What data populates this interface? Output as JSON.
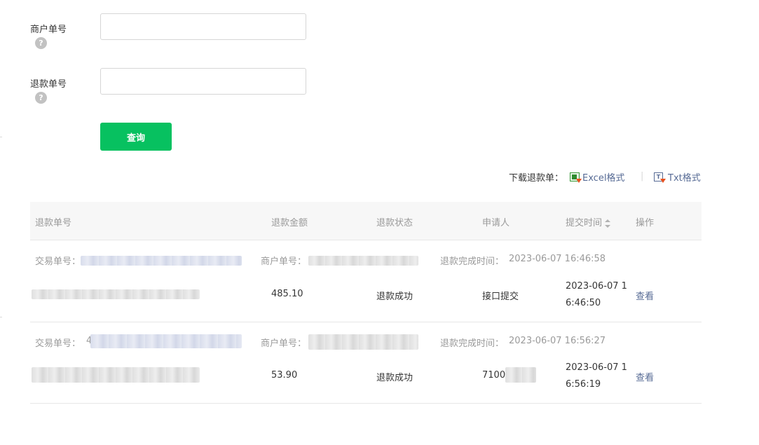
{
  "form": {
    "merchant_order_label": "商户单号",
    "refund_order_label": "退款单号",
    "help_glyph": "?",
    "merchant_order_value": "",
    "refund_order_value": "",
    "query_button": "查询"
  },
  "download": {
    "label": "下载退款单：",
    "excel_label": "Excel格式",
    "separator": "|",
    "txt_label": "Txt格式",
    "txt_icon_glyph": "T"
  },
  "table": {
    "columns": {
      "refund_no": "退款单号",
      "amount": "退款金额",
      "status": "退款状态",
      "applicant": "申请人",
      "submit_time": "提交时间",
      "action": "操作"
    },
    "records": [
      {
        "trade_no_label": "交易单号：",
        "merchant_no_label": "商户单号：",
        "completed_label": "退款完成时间：",
        "completed_time": "2023-06-07 16:46:58",
        "amount": "485.10",
        "status": "退款成功",
        "applicant": "接口提交",
        "submit_time": "2023-06-07 16:46:50",
        "action": "查看"
      },
      {
        "trade_no_label": "交易单号：",
        "trade_no_prefix": "4",
        "merchant_no_label": "商户单号：",
        "completed_label": "退款完成时间：",
        "completed_time": "2023-06-07 16:56:27",
        "amount": "53.90",
        "status": "退款成功",
        "applicant": "7100",
        "submit_time": "2023-06-07 16:56:19",
        "action": "查看"
      }
    ]
  },
  "colors": {
    "accent_green": "#07c160",
    "link_blue": "#576b95",
    "muted_text": "#9a9a9a"
  }
}
